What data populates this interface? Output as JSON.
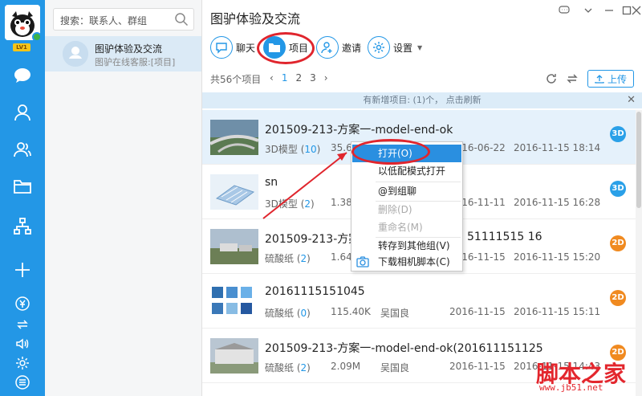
{
  "rail": {
    "level": "LV1"
  },
  "contacts": {
    "search_placeholder": "搜索：联系人、群组",
    "group": {
      "title": "图驴体验及交流",
      "subtitle": "图驴在线客服:[项目]"
    }
  },
  "main": {
    "title": "图驴体验及交流",
    "toolbar": {
      "chat": "聊天",
      "project": "项目",
      "invite": "邀请",
      "settings": "设置"
    },
    "count": "共56个项目",
    "pages": [
      "1",
      "2",
      "3"
    ],
    "upload": "上传",
    "notice": "有新增项目: (1)个， 点击刷新",
    "rows": [
      {
        "title": "201509-213-方案一-model-end-ok",
        "type": "3D模型",
        "count": "10",
        "size": "35.61",
        "owner": "",
        "date1": "2016-06-22",
        "date2": "2016-11-15 18:14",
        "badge": "3D"
      },
      {
        "title": "sn",
        "type": "3D模型",
        "count": "2",
        "size": "1.38M",
        "owner": "",
        "date1": "2016-11-11",
        "date2": "2016-11-15 16:28",
        "badge": "3D"
      },
      {
        "title": "201509-213-方案一",
        "title_tail": "51111515 16",
        "type": "硫酸纸",
        "count": "2",
        "size": "1.64M",
        "owner": "",
        "date1": "2016-11-15",
        "date2": "2016-11-15 15:20",
        "badge": "2D"
      },
      {
        "title": "20161115151045",
        "type": "硫酸纸",
        "count": "0",
        "size": "115.40K",
        "owner": "吴国良",
        "date1": "2016-11-15",
        "date2": "2016-11-15 15:11",
        "badge": "2D"
      },
      {
        "title": "201509-213-方案一-model-end-ok(201611151125",
        "type": "硫酸纸",
        "count": "2",
        "size": "2.09M",
        "owner": "吴国良",
        "date1": "2016-11-15",
        "date2": "2016-11-15 14:43",
        "badge": "2D"
      }
    ]
  },
  "context_menu": {
    "open": "打开(O)",
    "open_low": "以低配模式打开",
    "at_chat": "@到组聊",
    "delete": "删除(D)",
    "rename": "重命名(M)",
    "move": "转存到其他组(V)",
    "download_script": "下载相机脚本(C)"
  },
  "watermark": {
    "main": "脚本之家",
    "sub": "www.jb51.net"
  },
  "colors": {
    "rail": "#2397e6",
    "accent": "#2397e6",
    "highlight_ring": "#e0252d",
    "badge_3d": "#2aa0e8",
    "badge_2d": "#f08a20"
  }
}
